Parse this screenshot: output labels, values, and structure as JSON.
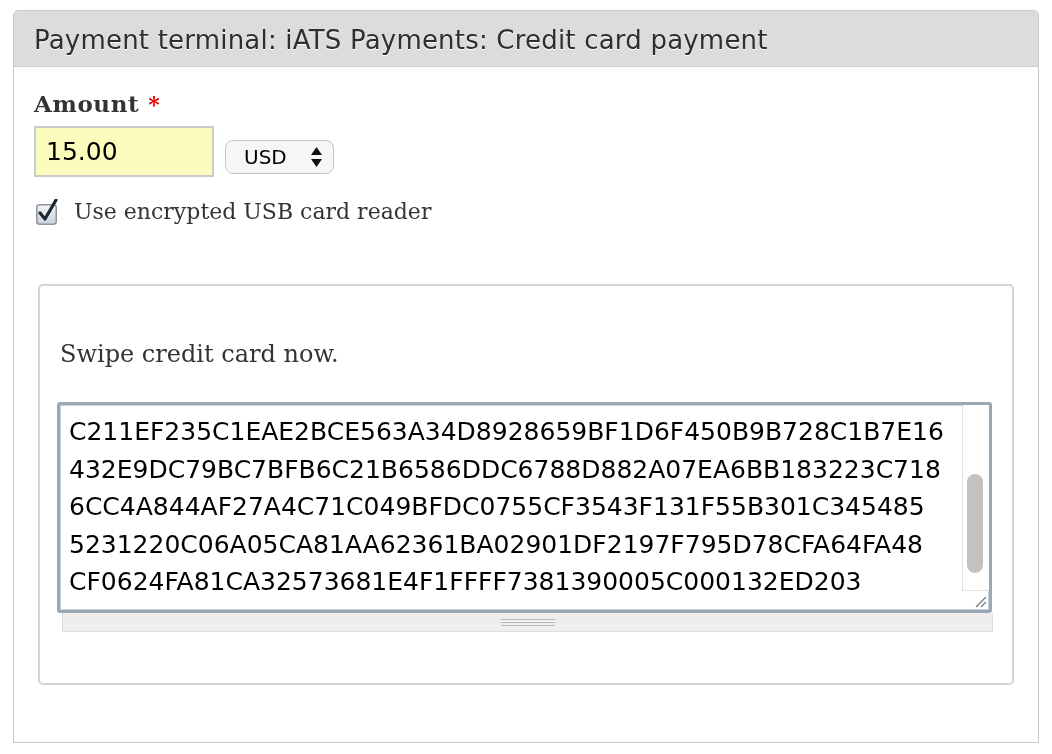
{
  "panel": {
    "title": "Payment terminal: iATS Payments: Credit card payment"
  },
  "amount": {
    "label": "Amount",
    "required_mark": "*",
    "value": "15.00",
    "currency": "USD"
  },
  "card_reader_checkbox": {
    "label": "Use encrypted USB card reader",
    "checked": true
  },
  "swipe_box": {
    "instruction": "Swipe credit card now.",
    "card_data_lines": [
      "C211EF235C1EAE2BCE563A34D8928659BF1D6F450B9B728C1B7E16",
      "432E9DC79BC7BFB6C21B6586DDC6788D882A07EA6BB183223C718",
      "6CC4A844AF27A4C71C049BFDC0755CF3543F131F55B301C345485",
      "5231220C06A05CA81AA62361BA02901DF2197F795D78CFA64FA48",
      "CF0624FA81CA32573681E4F1FFFF7381390005C000132ED203"
    ]
  }
}
